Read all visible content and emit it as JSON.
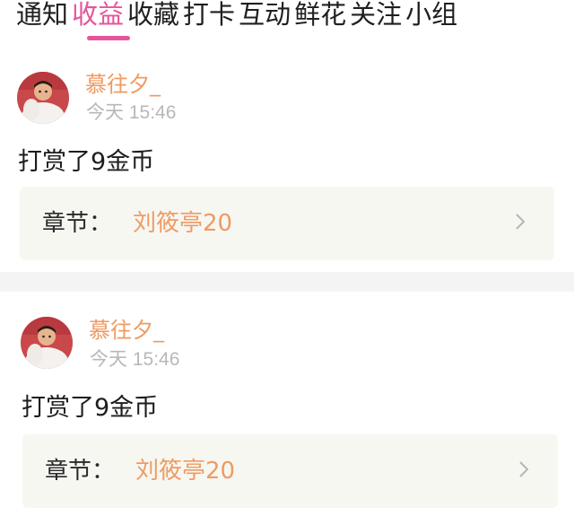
{
  "tabs": [
    {
      "label": "通知"
    },
    {
      "label": "收益"
    },
    {
      "label": "收藏"
    },
    {
      "label": "打卡"
    },
    {
      "label": "互动"
    },
    {
      "label": "鲜花"
    },
    {
      "label": "关注"
    },
    {
      "label": "小组"
    }
  ],
  "active_tab": "收益",
  "colors": {
    "accent": "#e5559a",
    "username": "#ef9b63",
    "chapter_link": "#ef9b63",
    "timestamp": "#b8b8b8",
    "box_bg": "#f7f7f2"
  },
  "notifications": [
    {
      "avatar_icon": "user-avatar-icon",
      "username": "慕往夕_",
      "time": "今天 15:46",
      "message": "打赏了9金币",
      "chapter_label": "章节：",
      "chapter_title": "刘筱亭20",
      "chevron_icon": "chevron-right-icon"
    },
    {
      "avatar_icon": "user-avatar-icon",
      "username": "慕往夕_",
      "time": "今天 15:46",
      "message": "打赏了9金币",
      "chapter_label": "章节：",
      "chapter_title": "刘筱亭20",
      "chevron_icon": "chevron-right-icon"
    }
  ]
}
